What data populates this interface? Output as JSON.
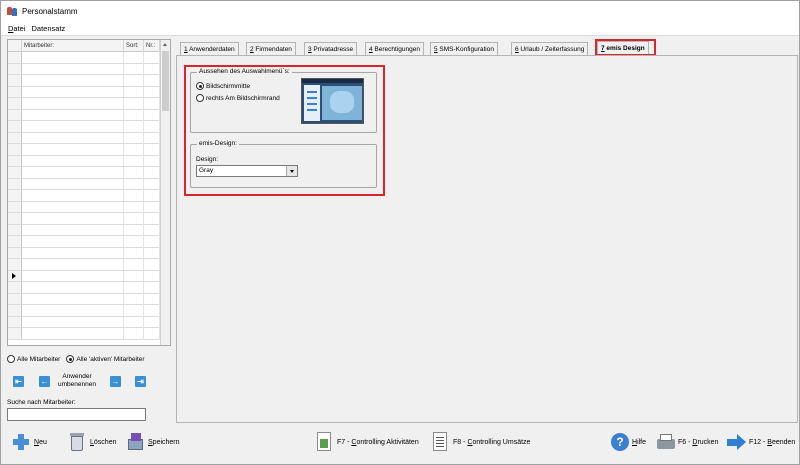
{
  "window": {
    "title": "Personalstamm"
  },
  "menu": [
    {
      "prefix": "",
      "mnemonic": "D",
      "rest": "atei"
    },
    {
      "prefix": "",
      "mnemonic": "",
      "rest": "Datensatz"
    }
  ],
  "grid": {
    "columns": [
      "Mitarbeiter:",
      "Sort:",
      "Nr.:"
    ],
    "row_count": 25
  },
  "filters": {
    "options": [
      "Alle Mitarbeiter",
      "Alle 'aktiven' Mitarbeiter"
    ],
    "selected": "Alle 'aktiven' Mitarbeiter"
  },
  "navigation": {
    "first_icon": "first-icon",
    "prev_icon": "prev-icon",
    "rename_label_line1": "Anwender",
    "rename_label_line2": "umbenennen",
    "next_icon": "next-icon",
    "last_icon": "last-icon"
  },
  "search": {
    "label": "Suche nach Mitarbeiter:",
    "value": ""
  },
  "tabs": [
    {
      "num": "1",
      "label": " Anwenderdaten"
    },
    {
      "num": "2",
      "label": " Firmendaten"
    },
    {
      "num": "3",
      "label": " Privatadresse"
    },
    {
      "num": "4",
      "label": " Berechtigungen"
    },
    {
      "num": "5",
      "label": " SMS-Konfiguration"
    },
    {
      "num": "6",
      "label": " Urlaub / Zeiterfassung"
    },
    {
      "num": "7",
      "label": " emis Design"
    }
  ],
  "active_tab": "7 emis Design",
  "menu_appearance": {
    "legend": "Aussehen des Auswahlmenü´s:",
    "options": [
      "Bildschirmmitte",
      "rechts Am Bildschirmrand"
    ],
    "selected": "Bildschirmmitte"
  },
  "emis_design": {
    "legend": "emis-Design:",
    "label": "Design:",
    "value": "Gray"
  },
  "toolbar": {
    "new": {
      "mnemonic": "N",
      "rest": "eu"
    },
    "delete": {
      "mnemonic": "L",
      "rest": "öschen"
    },
    "save": {
      "mnemonic": "S",
      "rest": "peichern"
    },
    "controlling_activities": {
      "prefix": "F7 - ",
      "mnemonic": "C",
      "rest": "ontrolling Aktivitäten"
    },
    "controlling_sales": {
      "prefix": "F8 - ",
      "mnemonic": "C",
      "rest": "ontrolling Umsätze"
    },
    "help": {
      "mnemonic": "H",
      "rest": "ilfe"
    },
    "print": {
      "prefix": "F6 - ",
      "mnemonic": "D",
      "rest": "rucken"
    },
    "exit": {
      "prefix": "F12 - ",
      "mnemonic": "B",
      "rest": "eenden"
    }
  },
  "colors": {
    "highlight_red": "#d9262e",
    "nav_blue": "#3b8fd6",
    "window_bg": "#f0f0f0"
  }
}
